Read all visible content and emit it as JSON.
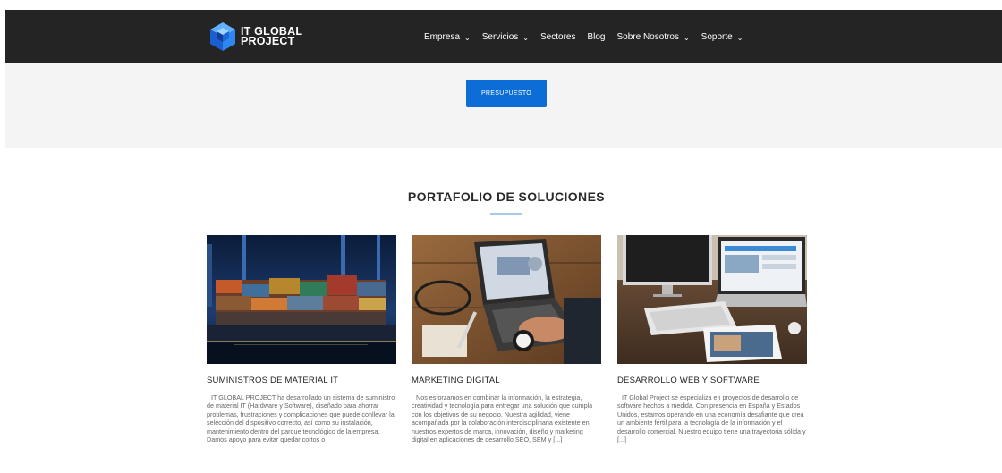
{
  "header": {
    "logo_line1": "IT GLOBAL",
    "logo_line2": "PROJECT",
    "nav": [
      {
        "label": "Empresa",
        "dropdown": true
      },
      {
        "label": "Servicios",
        "dropdown": true
      },
      {
        "label": "Sectores",
        "dropdown": false
      },
      {
        "label": "Blog",
        "dropdown": false
      },
      {
        "label": "Sobre Nosotros",
        "dropdown": true
      },
      {
        "label": "Soporte",
        "dropdown": true
      }
    ]
  },
  "band": {
    "button_label": "PRESUPUESTO"
  },
  "portfolio": {
    "title": "PORTAFOLIO DE SOLUCIONES",
    "cards": [
      {
        "title": "SUMINISTROS DE MATERIAL IT",
        "text": "IT GLOBAL PROJECT ha desarrollado un sistema de suministro de material IT (Hardware y Software), diseñado para ahorrar problemas, frustraciones y complicaciones que puede conllevar la selección del dispositivo correcto, así como su instalación, mantenimiento dentro del parque tecnológico de la empresa. Damos apoyo para evitar quedar cortos o"
      },
      {
        "title": "MARKETING DIGITAL",
        "text": "Nos esforzamos en combinar la información, la estrategia, creatividad y tecnología para entregar una solución que cumpla con los objetivos de su negocio. Nuestra agilidad, viene acompañada por la colaboración interdisciplinaria existente en nuestros expertos de marca, innovación, diseño y marketing digital en aplicaciones de desarrollo SEO, SEM y [...]"
      },
      {
        "title": "DESARROLLO WEB Y SOFTWARE",
        "text": "IT Global Project se especializa en proyectos de desarrollo de software hechos a medida. Con presencia en España y Estados Unidos, estamos operando en una economía desafiante que crea un ambiente fértil para la tecnología de la información y el desarrollo comercial. Nuestro equipo tiene una trayectoria sólida y [...]"
      }
    ]
  },
  "colors": {
    "nav_bg": "#242424",
    "band_bg": "#f4f4f4",
    "accent": "#0d6dd6",
    "title_rule": "#a9c9e8"
  }
}
